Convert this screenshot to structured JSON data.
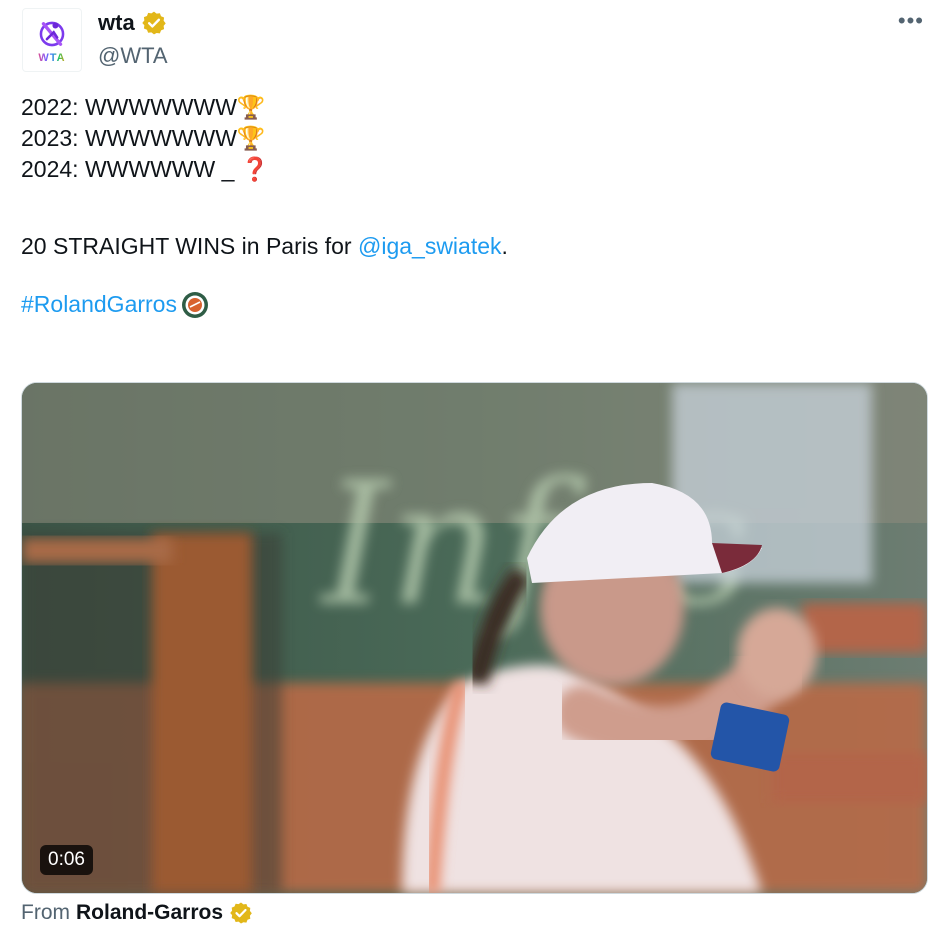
{
  "author": {
    "display_name": "wta",
    "handle": "@WTA",
    "logo_text": "WTA"
  },
  "more_label": "•••",
  "tweet": {
    "line1_text": "2022: WWWWWWW",
    "line1_emoji": "🏆",
    "line2_text": "2023: WWWWWWW",
    "line2_emoji": "🏆",
    "line3_text": "2024: WWWWWW _ ",
    "line3_emoji": "❓",
    "line4_prefix": "20 STRAIGHT WINS in Paris for ",
    "mention": "@iga_swiatek",
    "line4_suffix": ".",
    "hashtag": "#RolandGarros"
  },
  "media": {
    "duration": "0:06",
    "sign_text": "Infos"
  },
  "source": {
    "prefix": "From",
    "name": "Roland-Garros"
  },
  "colors": {
    "link": "#1d9bf0",
    "verified": "#e2b719",
    "muted": "#536471"
  }
}
